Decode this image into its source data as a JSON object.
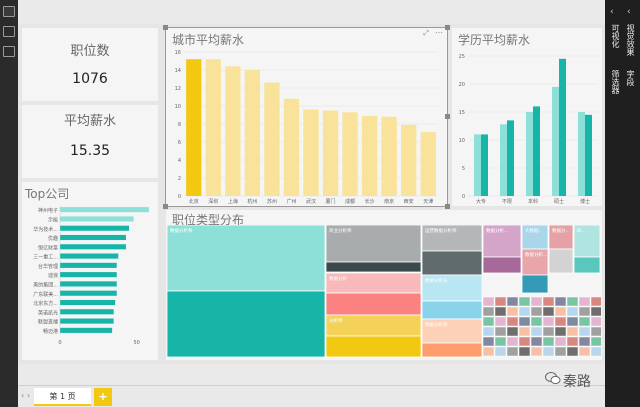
{
  "left_nav": {
    "icons": [
      "report-view-icon",
      "data-view-icon",
      "relationship-view-icon"
    ]
  },
  "kpi_jobs": {
    "title": "职位数",
    "value": "1076"
  },
  "kpi_salary": {
    "title": "平均薪水",
    "value": "15.35"
  },
  "top_company": {
    "title": "Top公司",
    "chart_data": {
      "type": "bar",
      "orientation": "horizontal",
      "title": "Top公司",
      "categories": [
        "神州电子",
        "示能",
        "华为技术...",
        "优趣",
        "恒亿财富",
        "三一重工...",
        "台华管理",
        "迪浪",
        "美的集团...",
        "广东联美...",
        "北京东方...",
        "英诺凯光",
        "联盟直播",
        "畅迈港"
      ],
      "values": [
        58,
        48,
        45,
        43,
        43,
        38,
        37,
        37,
        37,
        37,
        36,
        35,
        35,
        34
      ],
      "xlim": [
        0,
        60
      ],
      "xticks": [
        "0",
        "50"
      ],
      "colors": [
        "#8de0d8",
        "#16b5a7"
      ]
    }
  },
  "city_salary": {
    "title": "城市平均薪水",
    "chart_data": {
      "type": "bar",
      "title": "城市平均薪水",
      "categories": [
        "北京",
        "深圳",
        "上海",
        "杭州",
        "苏州",
        "广州",
        "武汉",
        "厦门",
        "成都",
        "长沙",
        "南京",
        "西安",
        "天津"
      ],
      "values": [
        15.2,
        15.2,
        14.4,
        14.0,
        12.6,
        10.8,
        9.6,
        9.5,
        9.3,
        8.9,
        8.8,
        7.9,
        7.1
      ],
      "ylim": [
        0,
        16
      ],
      "yticks": [
        0,
        2,
        4,
        6,
        8,
        10,
        12,
        14,
        16
      ],
      "highlight_color": "#f2c811",
      "base_color": "#f9e29a"
    }
  },
  "edu_salary": {
    "title": "学历平均薪水",
    "chart_data": {
      "type": "bar",
      "title": "学历平均薪水",
      "categories": [
        "大专",
        "不限",
        "本科",
        "硕士",
        "博士"
      ],
      "series": [
        {
          "values": [
            11.0,
            12.8,
            15.0,
            19.5,
            15.0
          ]
        },
        {
          "values": [
            11.0,
            13.5,
            16.0,
            24.5,
            14.5
          ]
        }
      ],
      "ylim": [
        0,
        25
      ],
      "yticks": [
        0,
        5,
        10,
        15,
        20,
        25
      ],
      "colors": [
        "#8de0d8",
        "#16b5a7"
      ]
    }
  },
  "job_type": {
    "title": "职位类型分布",
    "cells": [
      {
        "label": "数据分析师",
        "color": "#8de0d8"
      },
      {
        "label": "",
        "color": "#16b5a7"
      },
      {
        "label": "商业分析师",
        "color": "#a9acad"
      },
      {
        "label": "",
        "color": "#3a4a4c"
      },
      {
        "label": "数据分析",
        "color": "#f7b9b9"
      },
      {
        "label": "",
        "color": "#fb8281"
      },
      {
        "label": "分析师",
        "color": "#f4d25a"
      },
      {
        "label": "",
        "color": "#f2c811"
      },
      {
        "label": "运营数据分析师",
        "color": "#b4b6b8"
      },
      {
        "label": "",
        "color": "#5f6b6d"
      },
      {
        "label": "数据分析员",
        "color": "#b8e6f2"
      },
      {
        "label": "",
        "color": "#8ad4eb"
      },
      {
        "label": "数据分析师",
        "color": "#fdd0b8"
      },
      {
        "label": "",
        "color": "#fd9d6c"
      },
      {
        "label": "数据分析...",
        "color": "#d4a5c9"
      },
      {
        "label": "大数据...",
        "color": "#a9d6e8"
      },
      {
        "label": "数据分...",
        "color": "#e5a1a5"
      },
      {
        "label": "BI...",
        "color": "#b0e4e0"
      },
      {
        "label": "数据分析...",
        "color": "#e8a5aa"
      },
      {
        "label": "",
        "color": "#a66999"
      },
      {
        "label": "",
        "color": "#3599b8"
      },
      {
        "label": "",
        "color": "#d3d3d3"
      },
      {
        "label": "",
        "color": "#5ac7bd"
      }
    ]
  },
  "bottom": {
    "page_tab": "第 1 页",
    "add": "+"
  },
  "right_panel": {
    "label_viz": "可视化",
    "label_fields": "字段",
    "label_filters": "筛选器",
    "label_format": "视觉效果"
  },
  "watermark": "秦路"
}
